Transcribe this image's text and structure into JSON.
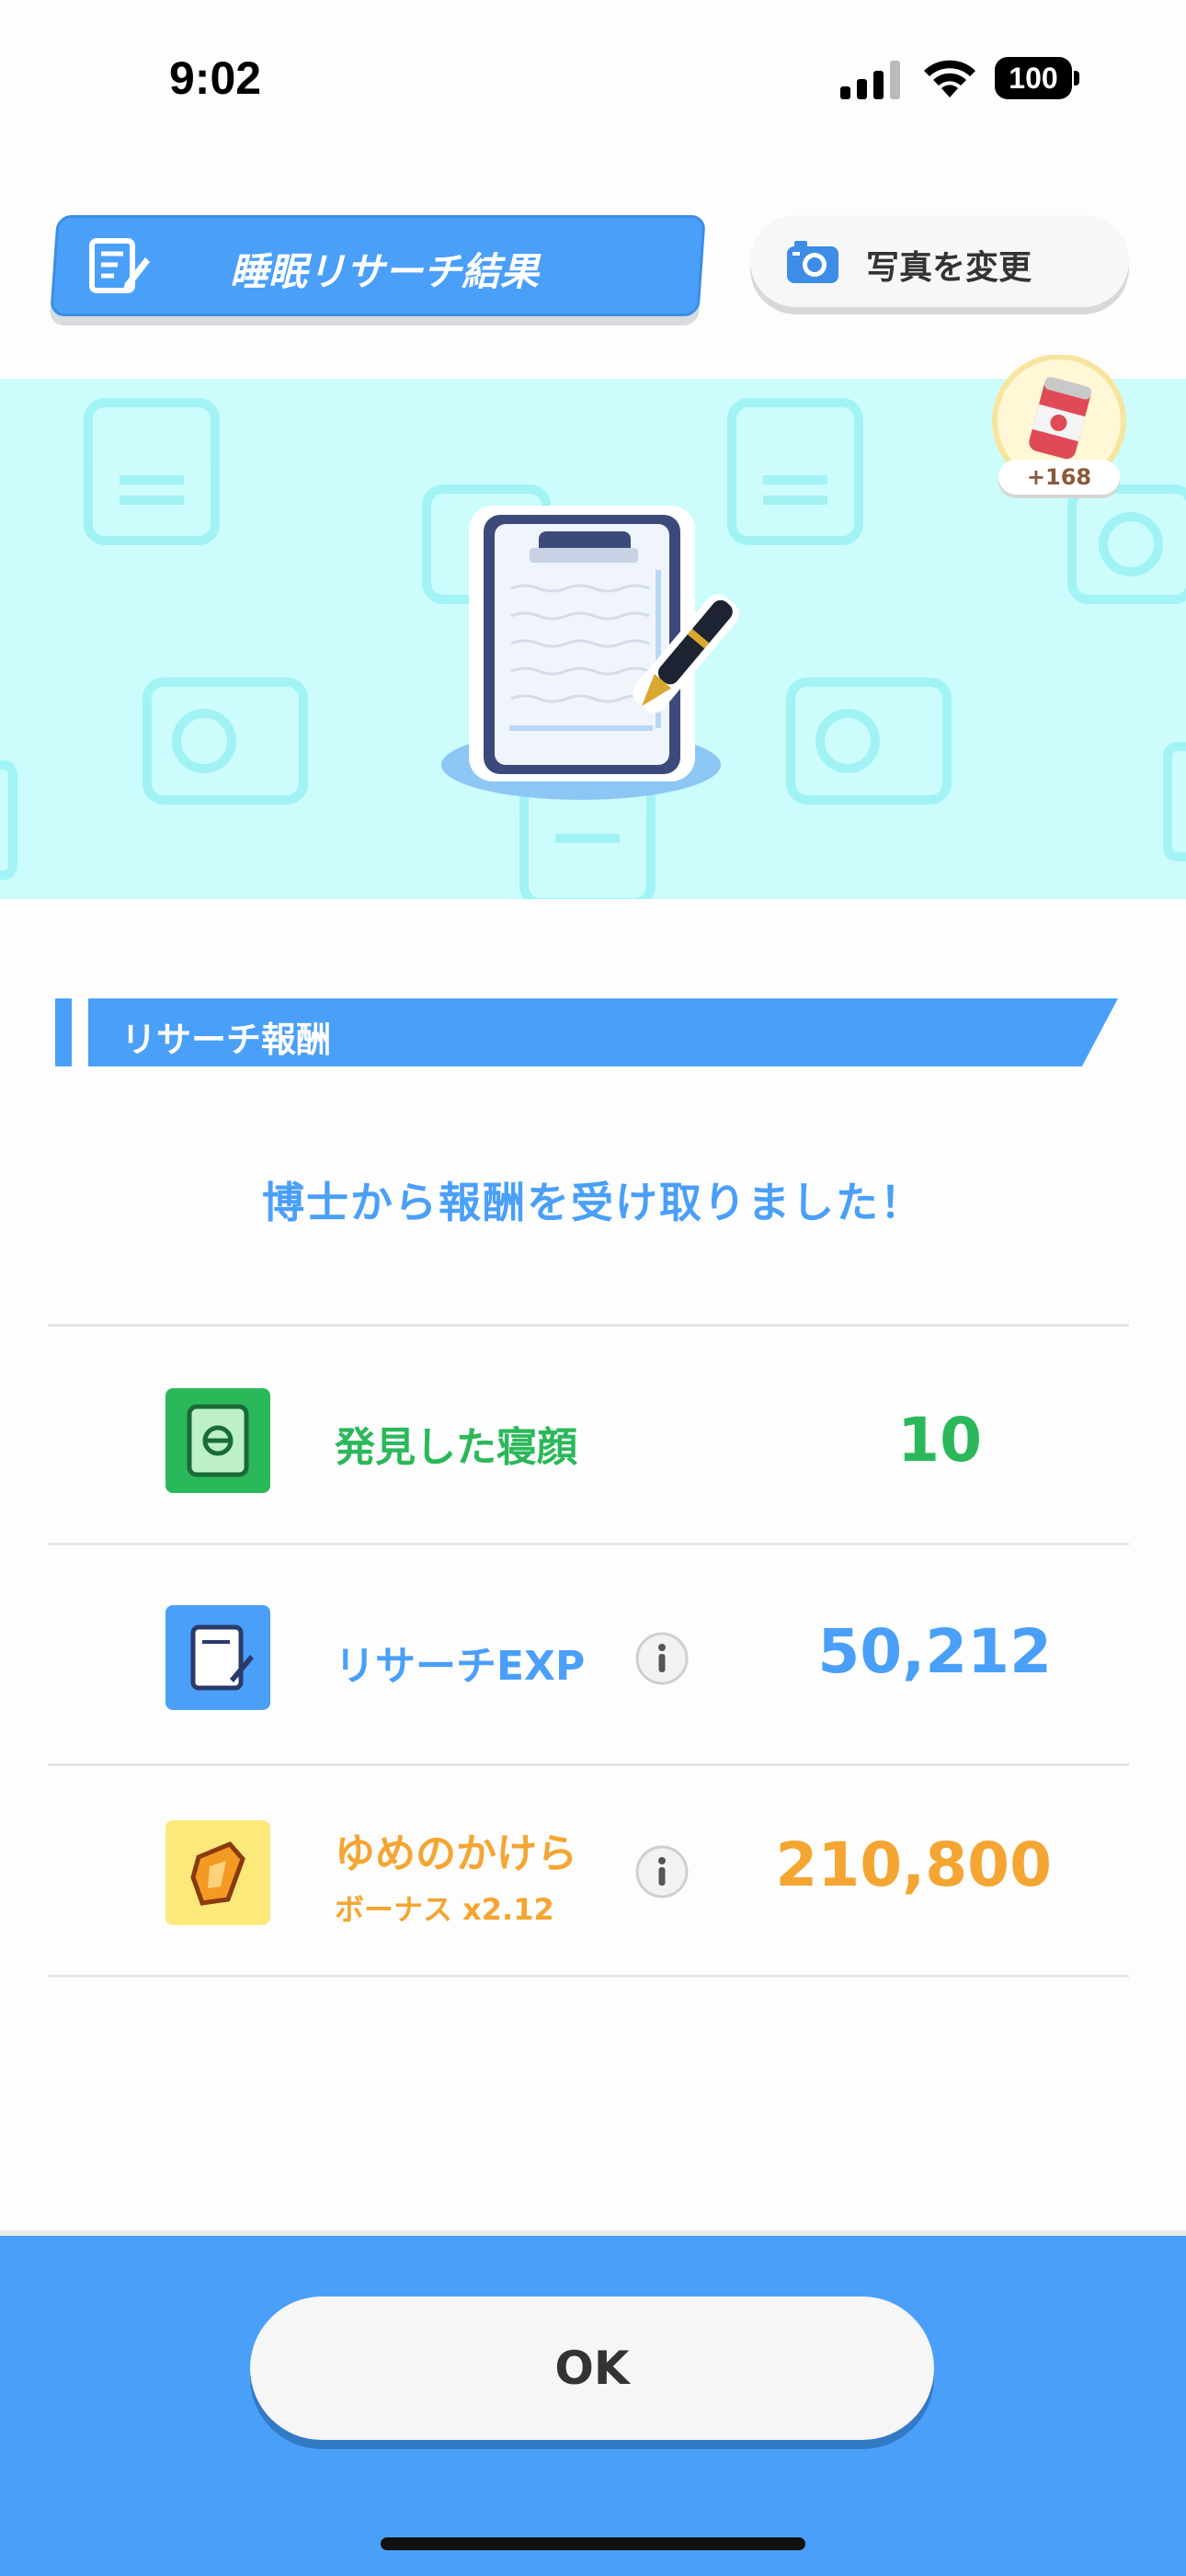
{
  "status_bar": {
    "time": "9:02",
    "battery": "100"
  },
  "header": {
    "title": "睡眠リサーチ結果",
    "photo_button": "写真を変更"
  },
  "badge": {
    "count": "+168"
  },
  "section": {
    "title": "リサーチ報酬",
    "message": "博士から報酬を受け取りました！"
  },
  "rewards": [
    {
      "label": "発見した寝顔",
      "value": "10",
      "color": "#2bb85a",
      "icon": "sleep-style-card-icon"
    },
    {
      "label": "リサーチEXP",
      "value": "50,212",
      "color": "#4a9ff8",
      "icon": "research-exp-icon"
    },
    {
      "label": "ゆめのかけら",
      "sub": "ボーナス x2.12",
      "value": "210,800",
      "color": "#f4a532",
      "icon": "dream-shards-icon"
    }
  ],
  "footer": {
    "ok_label": "OK"
  }
}
